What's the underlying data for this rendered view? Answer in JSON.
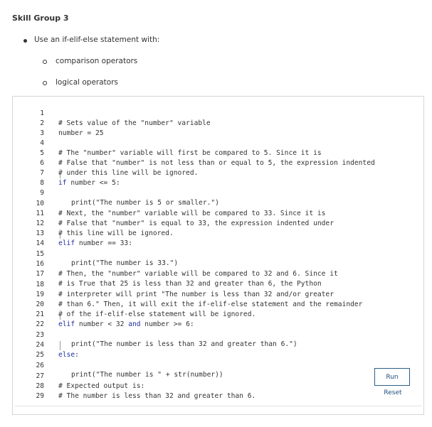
{
  "heading": "Skill Group 3",
  "bullets": {
    "main": "Use an if-elif-else statement with:",
    "sub1": "comparison operators",
    "sub2": "logical operators"
  },
  "code": {
    "lines": [
      {
        "num": "1",
        "text": "# Sets value of the \"number\" variable"
      },
      {
        "num": "2",
        "text": "number = 25"
      },
      {
        "num": "3",
        "text": ""
      },
      {
        "num": "4",
        "text": "# The \"number\" variable will first be compared to 5. Since it is"
      },
      {
        "num": "5",
        "text": "# False that \"number\" is not less than or equal to 5, the expression indented"
      },
      {
        "num": "6",
        "text": "# under this line will be ignored."
      },
      {
        "num": "7",
        "kw": "if",
        "text": " number <= 5:"
      },
      {
        "num": "8",
        "text": "print(\"The number is 5 or smaller.\")"
      },
      {
        "num": "9",
        "text": ""
      },
      {
        "num": "10",
        "text": "# Next, the \"number\" variable will be compared to 33. Since it is"
      },
      {
        "num": "11",
        "text": "# False that \"number\" is equal to 33, the expression indented under"
      },
      {
        "num": "12",
        "text": "# this line will be ignored."
      },
      {
        "num": "13",
        "kw": "elif",
        "text": " number == 33:"
      },
      {
        "num": "14",
        "text": "print(\"The number is 33.\")"
      },
      {
        "num": "15",
        "text": ""
      },
      {
        "num": "16",
        "text": "# Then, the \"number\" variable will be compared to 32 and 6. Since it"
      },
      {
        "num": "17",
        "text": "# is True that 25 is less than 32 and greater than 6, the Python"
      },
      {
        "num": "18",
        "text": "# interpreter will print \"The number is less than 32 and/or greater"
      },
      {
        "num": "19",
        "text": "# than 6.\" Then, it will exit the if-elif-else statement and the remainder"
      },
      {
        "num": "20",
        "text": "# of the if-elif-else statement will be ignored."
      },
      {
        "num": "21",
        "kw": "elif",
        "text": " number < 32 ",
        "kw2": "and",
        "text2": " number >= 6:"
      },
      {
        "num": "22",
        "text": "print(\"The number is less than 32 and greater than 6.\")"
      },
      {
        "num": "23",
        "text": ""
      },
      {
        "num": "24",
        "kw": "else",
        "text": ":"
      },
      {
        "num": "25",
        "text": "print(\"The number is \" + str(number))"
      },
      {
        "num": "26",
        "text": ""
      },
      {
        "num": "27",
        "text": "# Expected output is:"
      },
      {
        "num": "28",
        "text": "# The number is less than 32 and greater than 6."
      },
      {
        "num": "29",
        "text": ""
      }
    ]
  },
  "controls": {
    "run_label": "Run",
    "reset_label": "Reset"
  }
}
